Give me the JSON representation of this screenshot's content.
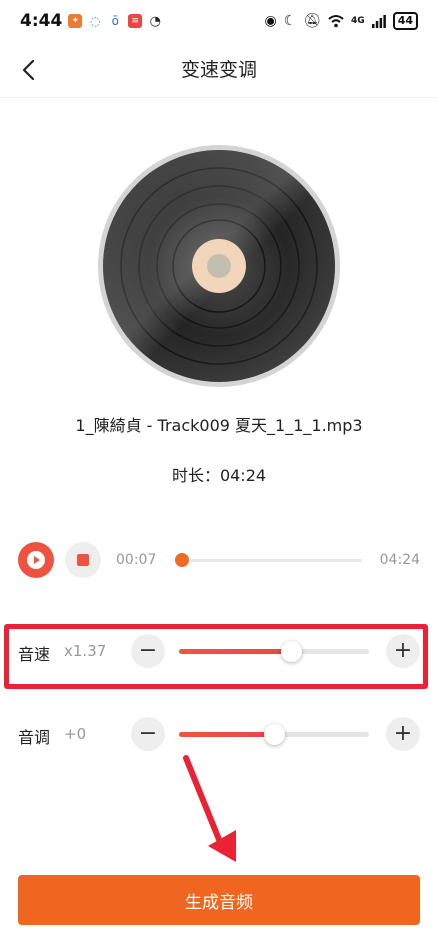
{
  "status_bar": {
    "time": "4:44",
    "notifications": [
      "app-icon",
      "chat-icon",
      "browser-icon",
      "app-icon",
      "speedometer-icon"
    ],
    "icons": [
      "eye-icon",
      "moon-icon",
      "mute-icon",
      "wifi-icon",
      "signal-icon"
    ],
    "signal_label": "4G",
    "battery": "44"
  },
  "header": {
    "title": "变速变调"
  },
  "track": {
    "name": "1_陳綺貞 - Track009 夏天_1_1_1.mp3",
    "duration_label": "时长：04:24"
  },
  "player": {
    "current_time": "00:07",
    "total_time": "04:24",
    "progress": 0.02
  },
  "speed": {
    "label": "音速",
    "value": "x1.37",
    "level": 0.59
  },
  "pitch": {
    "label": "音调",
    "value": "+0",
    "level": 0.5
  },
  "controls": {
    "minus": "−",
    "plus": "+"
  },
  "action": {
    "generate_label": "生成音频"
  },
  "colors": {
    "accent": "#f0651f",
    "slider": "#ef5240",
    "highlight": "#ea2235"
  }
}
